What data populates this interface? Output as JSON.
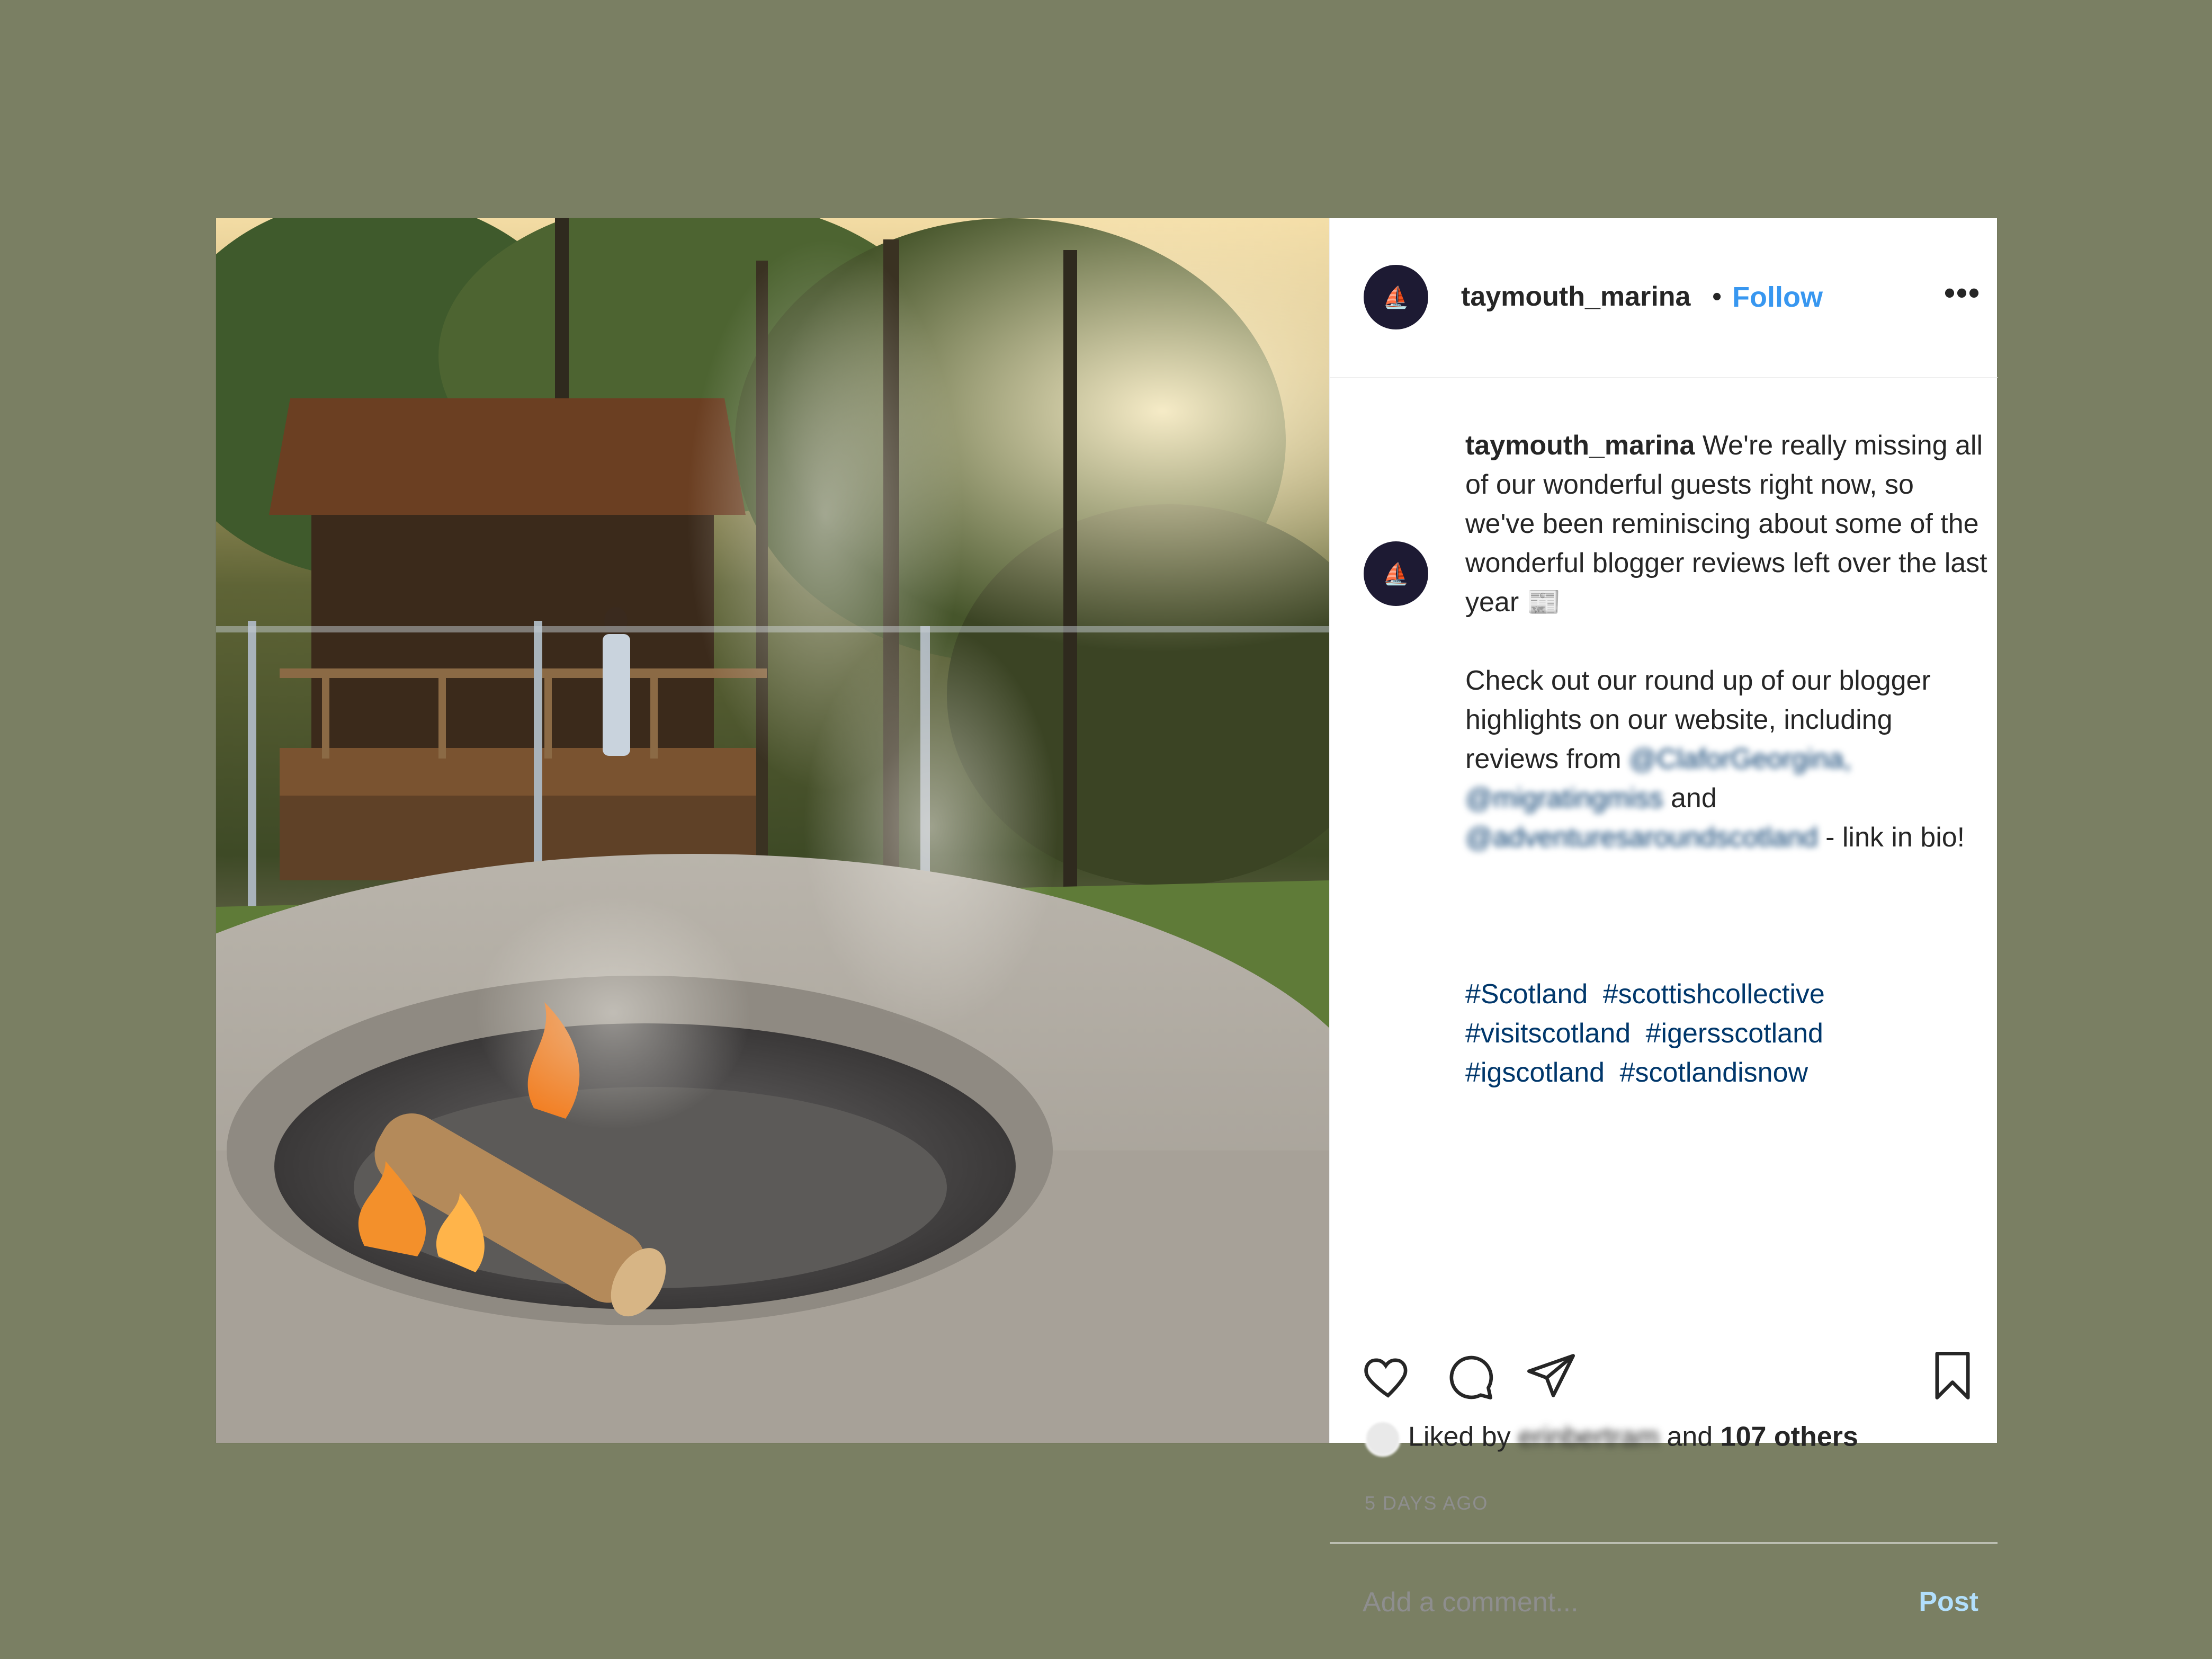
{
  "post": {
    "username": "taymouth_marina",
    "separator": "•",
    "follow_label": "Follow",
    "more_label": "•••",
    "caption": {
      "username": "taymouth_marina",
      "line1": "We're really missing all of our wonderful guests right now, so we've been reminiscing about some of the wonderful blogger reviews left over the last year 📰",
      "line2_a": "Check out our round up of our blogger highlights on our website, including reviews from ",
      "mention1": "@ClaforGeorgina,",
      "mention2": "@migratingmiss",
      "and_text": " and ",
      "mention3": "@adventuresaroundscotland",
      "line2_b": " - link in bio!"
    },
    "hashtags": [
      "#Scotland",
      "#scottishcollective",
      "#visitscotland",
      "#igersscotland",
      "#igscotland",
      "#scotlandisnow"
    ],
    "likes": {
      "prefix": "Liked by ",
      "blurred_name": "erinbertram",
      "mid": " and ",
      "others": "107 others"
    },
    "timestamp": "5 DAYS AGO",
    "comment": {
      "placeholder": "Add a comment...",
      "post_label": "Post"
    }
  },
  "colors": {
    "background": "#7a7f63",
    "follow": "#3897f0",
    "hashtag": "#00376b",
    "post_disabled": "#b2dffc"
  }
}
